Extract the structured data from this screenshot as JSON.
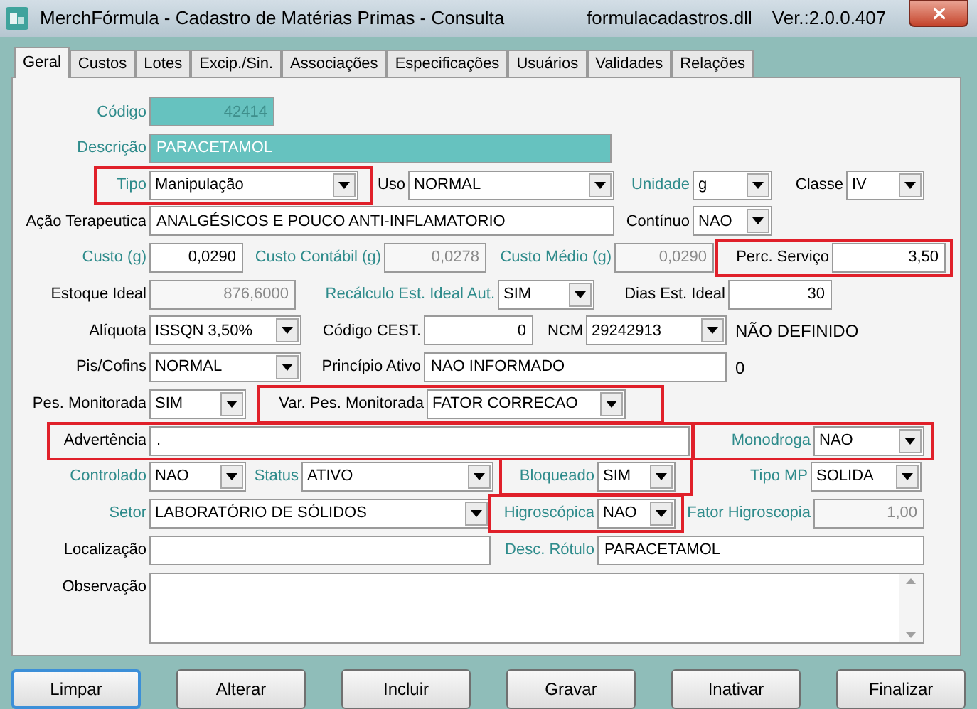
{
  "window": {
    "title": "MerchFórmula - Cadastro de Matérias Primas - Consulta",
    "module": "formulacadastros.dll",
    "version": "Ver.:2.0.0.407"
  },
  "tabs": [
    {
      "label": "Geral",
      "selected": true
    },
    {
      "label": "Custos",
      "selected": false
    },
    {
      "label": "Lotes",
      "selected": false
    },
    {
      "label": "Excip./Sin.",
      "selected": false
    },
    {
      "label": "Associações",
      "selected": false
    },
    {
      "label": "Especificações",
      "selected": false
    },
    {
      "label": "Usuários",
      "selected": false
    },
    {
      "label": "Validades",
      "selected": false
    },
    {
      "label": "Relações",
      "selected": false
    }
  ],
  "rows": [
    [
      {
        "label": "Código",
        "value": "42414",
        "kind": "key",
        "disabled": true,
        "highlighted": false,
        "color": "#2e8b8b"
      }
    ],
    [
      {
        "label": "Descrição",
        "value": "PARACETAMOL",
        "kind": "key",
        "disabled": false,
        "highlighted": false,
        "color": "#2e8b8b"
      }
    ],
    [
      {
        "label": "Tipo",
        "value": "Manipulação",
        "kind": "combo",
        "highlighted": true,
        "color": "#2e8b8b"
      },
      {
        "label": "Uso",
        "value": "NORMAL",
        "kind": "combo",
        "highlighted": false,
        "color": "#000000"
      },
      {
        "label": "Unidade",
        "value": "g",
        "kind": "combo",
        "highlighted": false,
        "color": "#2e8b8b"
      },
      {
        "label": "Classe",
        "value": "IV",
        "kind": "combo",
        "highlighted": false,
        "color": "#000000"
      }
    ],
    [
      {
        "label": "Ação Terapeutica",
        "value": "ANALGÉSICOS E POUCO ANTI-INFLAMATORIO",
        "kind": "text",
        "disabled": false,
        "highlighted": false,
        "color": "#000000"
      },
      {
        "label": "Contínuo",
        "value": "NAO",
        "kind": "combo",
        "highlighted": false,
        "color": "#000000"
      }
    ],
    [
      {
        "label": "Custo (g)",
        "value": "0,0290",
        "kind": "number",
        "disabled": false,
        "highlighted": false,
        "color": "#2e8b8b"
      },
      {
        "label": "Custo Contábil (g)",
        "value": "0,0278",
        "kind": "number",
        "disabled": true,
        "highlighted": false,
        "color": "#2e8b8b"
      },
      {
        "label": "Custo Médio (g)",
        "value": "0,0290",
        "kind": "number",
        "disabled": true,
        "highlighted": false,
        "color": "#2e8b8b"
      },
      {
        "label": "Perc. Serviço",
        "value": "3,50",
        "kind": "number",
        "disabled": false,
        "highlighted": true,
        "color": "#000000"
      }
    ],
    [
      {
        "label": "Estoque Ideal",
        "value": "876,6000",
        "kind": "number",
        "disabled": true,
        "highlighted": false,
        "color": "#000000"
      },
      {
        "label": "Recálculo Est. Ideal Aut.",
        "value": "SIM",
        "kind": "combo",
        "highlighted": false,
        "color": "#2e8b8b"
      },
      {
        "label": "Dias Est. Ideal",
        "value": "30",
        "kind": "number",
        "disabled": false,
        "highlighted": false,
        "color": "#000000"
      }
    ],
    [
      {
        "label": "Alíquota",
        "value": "ISSQN 3,50%",
        "kind": "combo",
        "highlighted": false,
        "color": "#000000"
      },
      {
        "label": "Código CEST.",
        "value": "0",
        "kind": "number",
        "disabled": false,
        "highlighted": false,
        "color": "#000000"
      },
      {
        "label": "NCM",
        "value": "29242913",
        "kind": "combo",
        "highlighted": false,
        "color": "#000000"
      },
      {
        "label": "NÃO DEFINIDO",
        "kind": "plain",
        "highlighted": false,
        "color": "#000000"
      }
    ],
    [
      {
        "label": "Pis/Cofins",
        "value": "NORMAL",
        "kind": "combo",
        "highlighted": false,
        "color": "#000000"
      },
      {
        "label": "Princípio Ativo",
        "value": "NAO INFORMADO",
        "kind": "text",
        "disabled": false,
        "highlighted": false,
        "color": "#000000"
      },
      {
        "label": "0",
        "kind": "plain",
        "highlighted": false,
        "color": "#000000"
      }
    ],
    [
      {
        "label": "Pes. Monitorada",
        "value": "SIM",
        "kind": "combo",
        "highlighted": false,
        "color": "#000000"
      },
      {
        "label": "Var. Pes. Monitorada",
        "value": "FATOR CORRECAO",
        "kind": "combo",
        "highlighted": true,
        "color": "#000000"
      }
    ],
    [
      {
        "label": "Advertência",
        "value": ".",
        "kind": "text",
        "disabled": false,
        "highlighted": true,
        "color": "#000000"
      },
      {
        "label": "Monodroga",
        "value": "NAO",
        "kind": "combo",
        "highlighted": true,
        "color": "#2e8b8b"
      }
    ],
    [
      {
        "label": "Controlado",
        "value": "NAO",
        "kind": "combo",
        "highlighted": false,
        "color": "#2e8b8b"
      },
      {
        "label": "Status",
        "value": "ATIVO",
        "kind": "combo",
        "highlighted": false,
        "color": "#2e8b8b"
      },
      {
        "label": "Bloqueado",
        "value": "SIM",
        "kind": "combo",
        "highlighted": true,
        "color": "#2e8b8b"
      },
      {
        "label": "Tipo MP",
        "value": "SOLIDA",
        "kind": "combo",
        "highlighted": false,
        "color": "#2e8b8b"
      }
    ],
    [
      {
        "label": "Setor",
        "value": "LABORATÓRIO DE SÓLIDOS",
        "kind": "combo",
        "highlighted": false,
        "color": "#2e8b8b"
      },
      {
        "label": "Higroscópica",
        "value": "NAO",
        "kind": "combo",
        "highlighted": true,
        "color": "#2e8b8b"
      },
      {
        "label": "Fator Higroscopia",
        "value": "1,00",
        "kind": "number",
        "disabled": true,
        "highlighted": false,
        "color": "#2e8b8b"
      }
    ],
    [
      {
        "label": "Localização",
        "kind": "text",
        "highlighted": false,
        "color": "#000000"
      },
      {
        "label": "Desc. Rótulo",
        "value": "PARACETAMOL",
        "kind": "text",
        "disabled": false,
        "highlighted": false,
        "color": "#2e8b8b"
      }
    ],
    [
      {
        "label": "Observação",
        "kind": "memo",
        "highlighted": false,
        "color": "#000000"
      }
    ]
  ],
  "buttons": [
    {
      "label": "Limpar",
      "focused": true
    },
    {
      "label": "Alterar",
      "focused": false
    },
    {
      "label": "Incluir",
      "focused": false
    },
    {
      "label": "Gravar",
      "focused": false
    },
    {
      "label": "Inativar",
      "focused": false
    },
    {
      "label": "Finalizar",
      "focused": false
    }
  ]
}
